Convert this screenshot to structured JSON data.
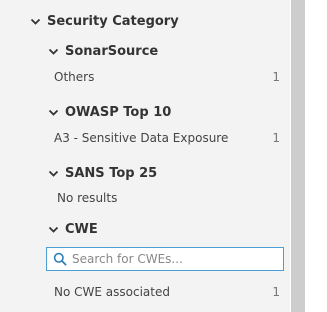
{
  "security_category": {
    "title": "Security Category",
    "groups": [
      {
        "title": "SonarSource",
        "items": [
          {
            "label": "Others",
            "count": "1"
          }
        ]
      },
      {
        "title": "OWASP Top 10",
        "items": [
          {
            "label": "A3 - Sensitive Data Exposure",
            "count": "1"
          }
        ]
      },
      {
        "title": "SANS Top 25",
        "empty_text": "No results"
      },
      {
        "title": "CWE",
        "search_placeholder": "Search for CWEs...",
        "items": [
          {
            "label": "No CWE associated",
            "count": "1"
          }
        ]
      }
    ]
  },
  "icons": {
    "expand": "chevron-down-icon",
    "search": "search-icon"
  },
  "colors": {
    "search_border": "#4b9fd5",
    "panel_background": "#f3f3f3",
    "scrollbar_thumb": "#cdcdcd"
  }
}
